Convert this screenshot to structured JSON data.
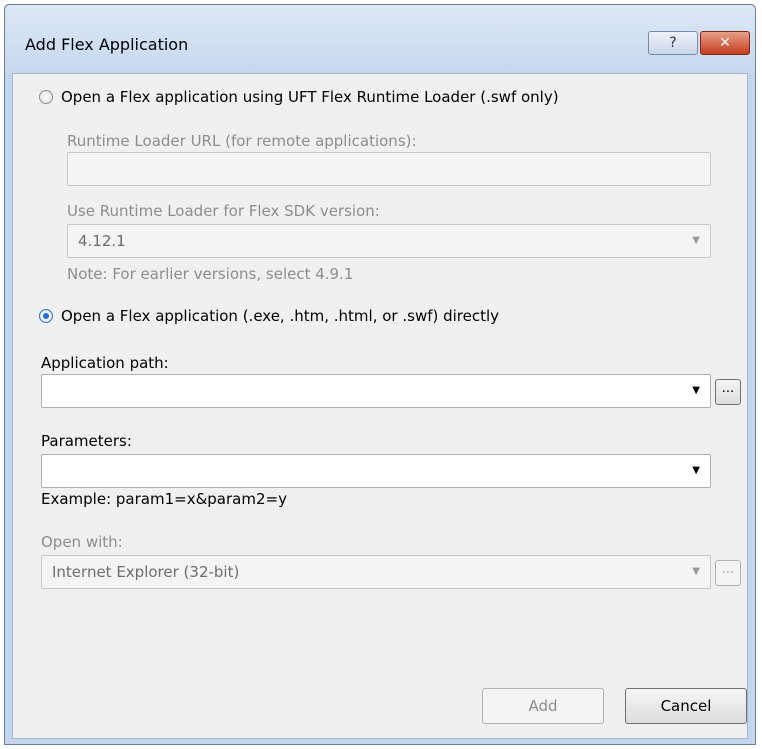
{
  "window": {
    "title": "Add Flex Application",
    "help_symbol": "?",
    "close_symbol": "✕"
  },
  "option_runtime_loader": {
    "label": "Open a Flex application using UFT Flex Runtime Loader (.swf only)",
    "selected": false,
    "url_label": "Runtime Loader URL (for remote applications):",
    "url_value": "",
    "sdk_label": "Use Runtime Loader for Flex SDK version:",
    "sdk_value": "4.12.1",
    "note": "Note: For earlier versions, select 4.9.1"
  },
  "option_direct": {
    "label": "Open a Flex application (.exe, .htm, .html, or .swf) directly",
    "selected": true
  },
  "app_path": {
    "label": "Application path:",
    "value": "",
    "browse_label": "..."
  },
  "parameters": {
    "label": "Parameters:",
    "value": "",
    "example": "Example: param1=x&param2=y"
  },
  "open_with": {
    "label": "Open with:",
    "value": "Internet Explorer (32-bit)",
    "browse_label": "..."
  },
  "buttons": {
    "add": "Add",
    "cancel": "Cancel"
  },
  "icons": {
    "dropdown": "▼"
  }
}
